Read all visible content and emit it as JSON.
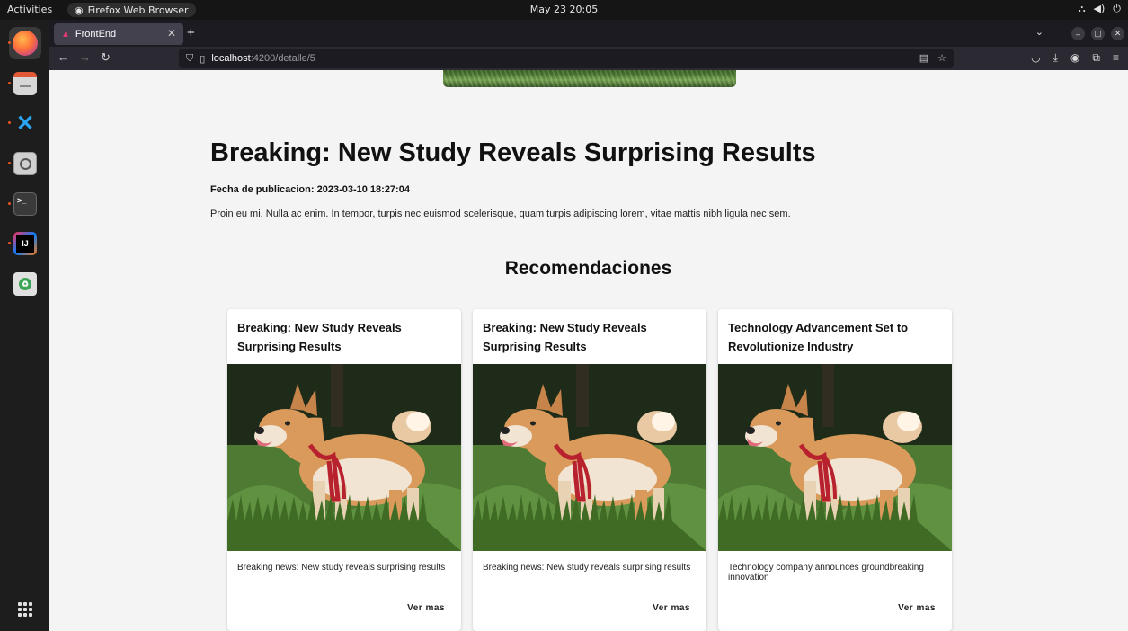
{
  "system": {
    "activities": "Activities",
    "app_name": "Firefox Web Browser",
    "clock": "May 23  20:05"
  },
  "browser": {
    "tab_title": "FrontEnd",
    "url_host": "localhost",
    "url_path": ":4200/detalle/5"
  },
  "article": {
    "title": "Breaking: New Study Reveals Surprising Results",
    "date_label": "Fecha de publicacion:",
    "date_value": "2023-03-10 18:27:04",
    "body": "Proin eu mi. Nulla ac enim. In tempor, turpis nec euismod scelerisque, quam turpis adipiscing lorem, vitae mattis nibh ligula nec sem."
  },
  "recommendations": {
    "heading": "Recomendaciones",
    "cards": [
      {
        "title": "Breaking: New Study Reveals Surprising Results",
        "description": "Breaking news: New study reveals surprising results",
        "button": "Ver mas"
      },
      {
        "title": "Breaking: New Study Reveals Surprising Results",
        "description": "Breaking news: New study reveals surprising results",
        "button": "Ver mas"
      },
      {
        "title": "Technology Advancement Set to Revolutionize Industry",
        "description": "Technology company announces groundbreaking innovation",
        "button": "Ver mas"
      }
    ]
  },
  "dock": {
    "items": [
      "firefox-icon",
      "files-icon",
      "vscode-icon",
      "magnifier-icon",
      "terminal-icon",
      "intellij-icon",
      "trash-icon"
    ]
  }
}
